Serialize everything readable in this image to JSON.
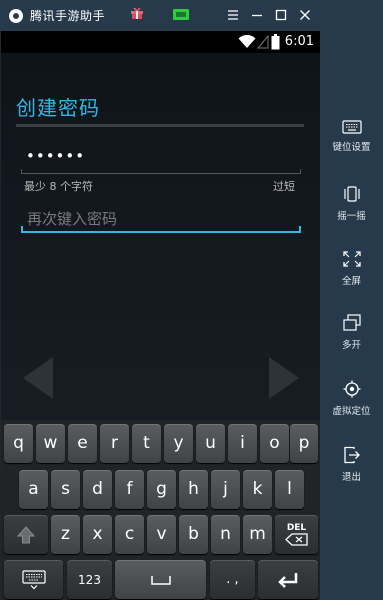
{
  "titlebar": {
    "title": "腾讯手游助手",
    "icons": [
      "app-logo-icon",
      "gift-icon",
      "screen-icon",
      "menu-icon",
      "minimize-icon",
      "maximize-icon",
      "close-icon"
    ]
  },
  "statusbar": {
    "time": "6:01",
    "icons": [
      "wifi-icon",
      "signal-icon",
      "battery-icon"
    ]
  },
  "screen": {
    "heading": "创建密码",
    "password_value": "••••••",
    "hint_left": "最少 8 个字符",
    "hint_right": "过短",
    "confirm_placeholder": "再次键入密码",
    "accent_color": "#33b5e5"
  },
  "keyboard": {
    "row1": [
      "q",
      "w",
      "e",
      "r",
      "t",
      "y",
      "u",
      "i",
      "o",
      "p"
    ],
    "row2": [
      "a",
      "s",
      "d",
      "f",
      "g",
      "h",
      "j",
      "k",
      "l"
    ],
    "row3": [
      "z",
      "x",
      "c",
      "v",
      "b",
      "n",
      "m"
    ],
    "del_label": "DEL",
    "num_label": "123",
    "punct_label": ". ,"
  },
  "sidebar": {
    "items": [
      {
        "label": "键位设置",
        "icon": "keyboard-icon"
      },
      {
        "label": "摇一摇",
        "icon": "shake-icon"
      },
      {
        "label": "全屏",
        "icon": "fullscreen-icon"
      },
      {
        "label": "多开",
        "icon": "multi-window-icon"
      },
      {
        "label": "虚拟定位",
        "icon": "location-icon"
      },
      {
        "label": "退出",
        "icon": "exit-icon"
      }
    ]
  }
}
